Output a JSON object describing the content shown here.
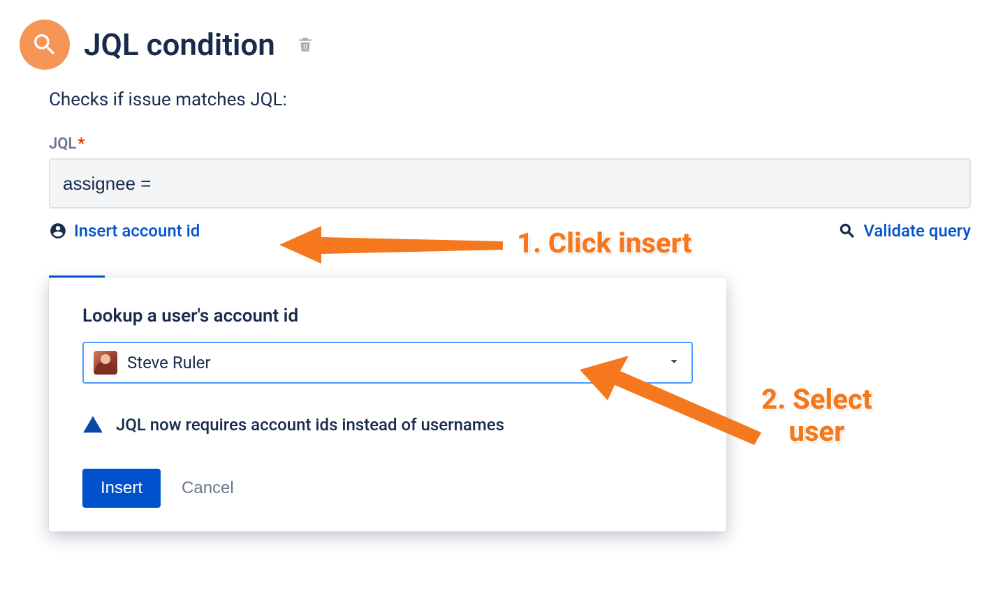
{
  "header": {
    "title": "JQL condition",
    "description": "Checks if issue matches JQL:"
  },
  "jql_field": {
    "label": "JQL",
    "value": "assignee ="
  },
  "actions": {
    "insert_account_id": "Insert account id",
    "validate_query": "Validate query"
  },
  "popup": {
    "title": "Lookup a user's account id",
    "selected_user": "Steve Ruler",
    "info_message": "JQL now requires account ids instead of usernames",
    "insert_button": "Insert",
    "cancel_button": "Cancel"
  },
  "annotations": {
    "step1": "1. Click insert",
    "step2_line1": "2. Select",
    "step2_line2": "user"
  }
}
